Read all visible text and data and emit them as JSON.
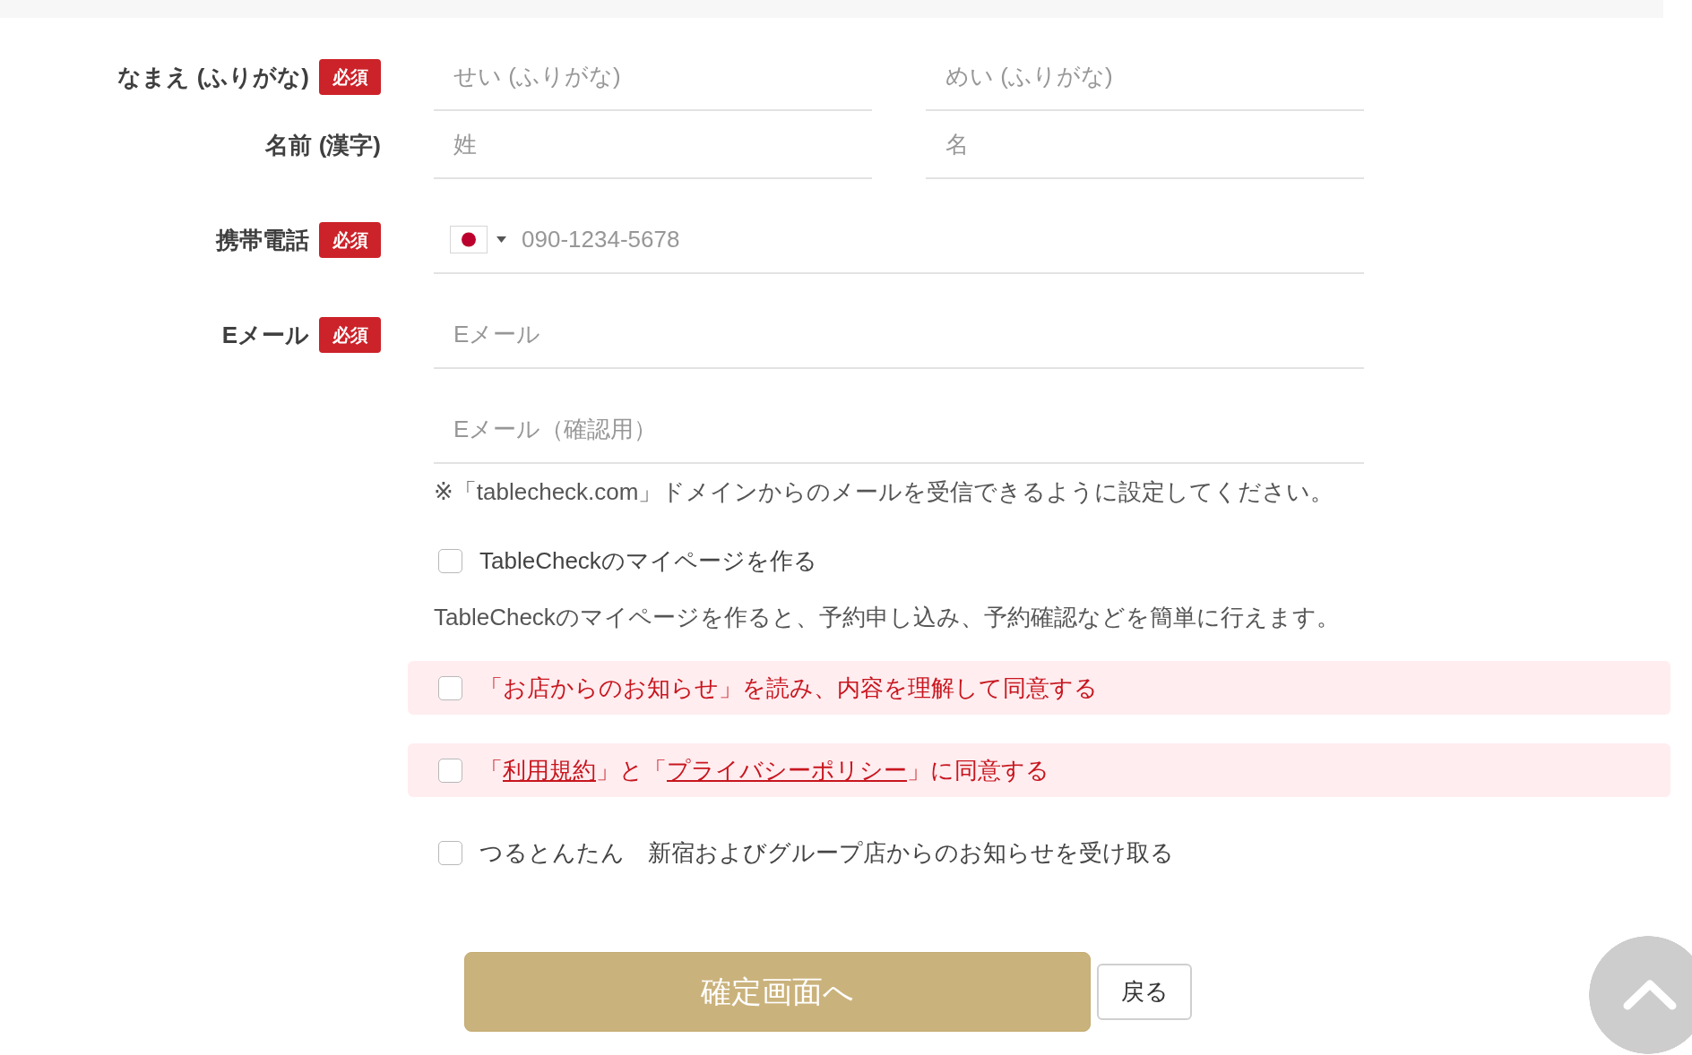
{
  "form": {
    "rows": [
      {
        "kind": "text",
        "label": "なまえ (ふりがな)",
        "badge": "必須",
        "inputs": [
          {
            "placeholder": "せい (ふりがな)"
          },
          {
            "placeholder": "めい (ふりがな)"
          }
        ]
      },
      {
        "kind": "text",
        "label": "名前 (漢字)",
        "inputs": [
          {
            "placeholder": "姓"
          },
          {
            "placeholder": "名"
          }
        ]
      },
      {
        "kind": "phone",
        "label": "携帯電話",
        "badge": "必須",
        "inputs": [
          {
            "placeholder": "090-1234-5678"
          }
        ]
      },
      {
        "kind": "text",
        "label": "Eメール",
        "badge": "必須",
        "inputs": [
          {
            "placeholder": "Eメール"
          }
        ]
      },
      {
        "kind": "text",
        "inputs": [
          {
            "placeholder": "Eメール（確認用）"
          }
        ]
      }
    ],
    "note": "※「tablecheck.com」ドメインからのメールを受信できるように設定してください。",
    "consents": [
      {
        "checked": false,
        "highlighted": false,
        "parts": [
          {
            "text": "TableCheckのマイページを作る",
            "link": false
          }
        ],
        "description": "TableCheckのマイページを作ると、予約申し込み、予約確認などを簡単に行えます。"
      },
      {
        "checked": false,
        "highlighted": true,
        "parts": [
          {
            "text": "「お店からのお知らせ」を読み、内容を理解して同意する",
            "link": false
          }
        ]
      },
      {
        "checked": false,
        "highlighted": true,
        "parts": [
          {
            "text": "「",
            "link": false
          },
          {
            "text": "利用規約",
            "link": true
          },
          {
            "text": "」と「",
            "link": false
          },
          {
            "text": "プライバシーポリシー",
            "link": true
          },
          {
            "text": "」に同意する",
            "link": false
          }
        ]
      },
      {
        "checked": false,
        "highlighted": false,
        "parts": [
          {
            "text": "つるとんたん　新宿およびグループ店からのお知らせを受け取る",
            "link": false
          }
        ]
      }
    ],
    "buttons": [
      {
        "kind": "primary",
        "label": "確定画面へ",
        "disabled": true
      },
      {
        "kind": "secondary",
        "label": "戻る",
        "disabled": false
      }
    ]
  }
}
